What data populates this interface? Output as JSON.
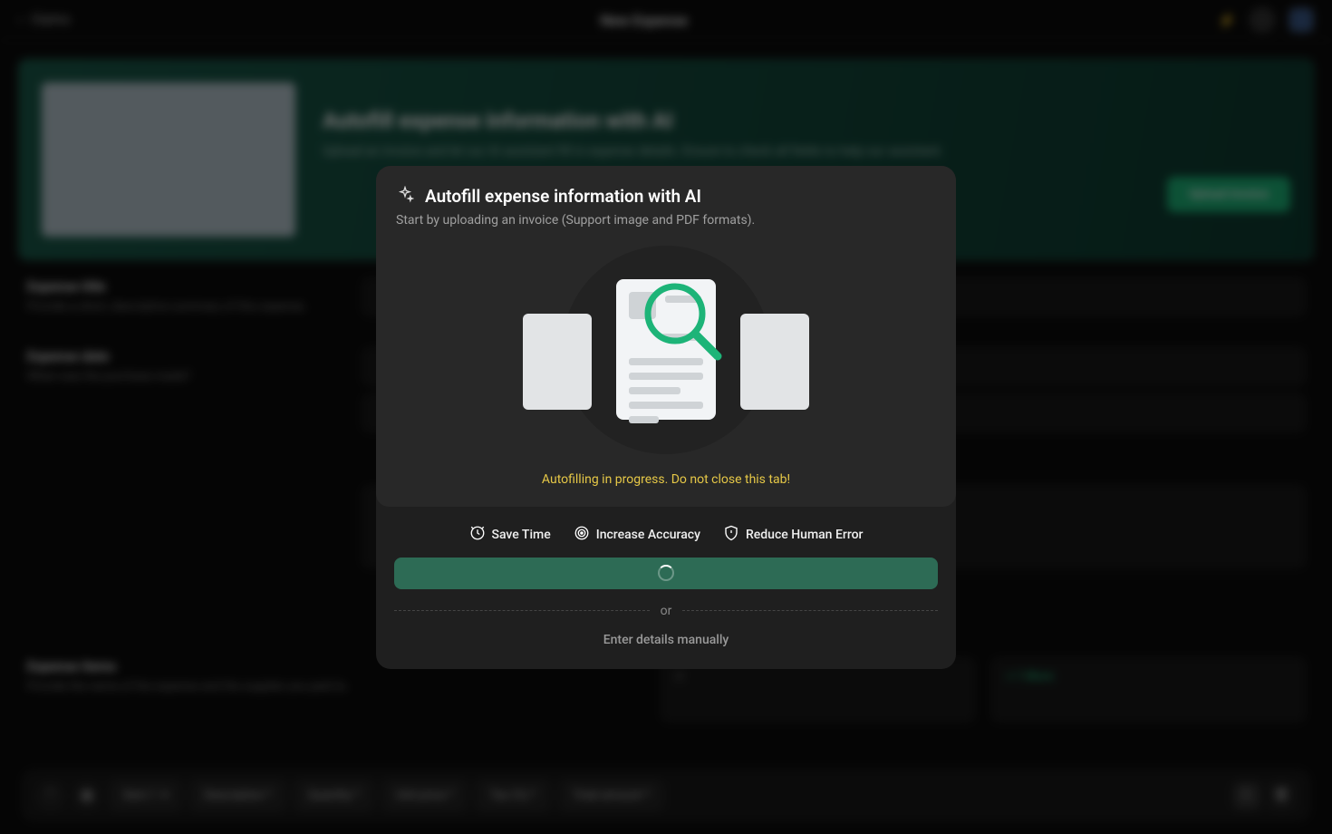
{
  "navigation": {
    "back_label": "Claims",
    "page_title": "New Expense"
  },
  "banner": {
    "title": "Autofill expense information with AI",
    "description": "Upload an invoice and let our AI assistant fill in expense details. Ensure to check all fields to help our assistant.",
    "button": "Upload invoice"
  },
  "form": {
    "expense_title_label": "Expense title",
    "expense_title_desc": "Provide a short, descriptive summary of this expense.",
    "expense_date_label": "Expense date",
    "expense_date_desc": "When was the purchase made?",
    "expense_items_label": "Expense items",
    "expense_items_desc": "Provide the name of the expense and the supplier you paid to."
  },
  "toolbar": {
    "item1": "Item 1",
    "desc": "Description *",
    "qty": "Quantity *",
    "price": "Unit price *",
    "tax": "Tax (%) *",
    "total": "Total amount *"
  },
  "modal": {
    "title": "Autofill expense information with AI",
    "subtitle": "Start by uploading an invoice (Support image and PDF formats).",
    "progress_message": "Autofilling in progress. Do not close this tab!",
    "benefit1": "Save Time",
    "benefit2": "Increase Accuracy",
    "benefit3": "Reduce Human Error",
    "separator": "or",
    "manual_link": "Enter details manually"
  }
}
